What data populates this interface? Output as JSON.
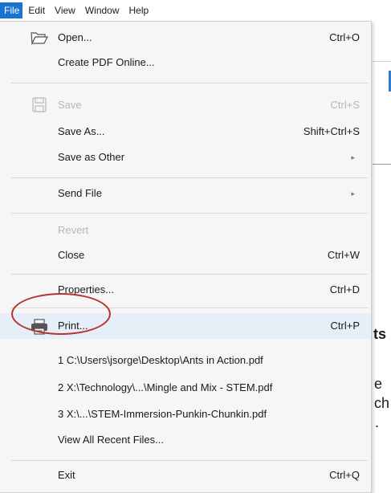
{
  "menubar": {
    "items": [
      "File",
      "Edit",
      "View",
      "Window",
      "Help"
    ],
    "active_color": "#1874d2"
  },
  "background_doc": {
    "fragment_ts": "ts",
    "fragment_e": "e",
    "fragment_ch": "ch",
    "fragment_dot": "."
  },
  "menu": {
    "open": {
      "label": "Open...",
      "shortcut": "Ctrl+O",
      "icon": "folder-open-icon"
    },
    "create": {
      "label": "Create PDF Online..."
    },
    "save": {
      "label": "Save",
      "shortcut": "Ctrl+S",
      "icon": "save-disk-icon",
      "disabled": true
    },
    "save_as": {
      "label": "Save As...",
      "shortcut": "Shift+Ctrl+S"
    },
    "save_other": {
      "label": "Save as Other",
      "arrow": "▸"
    },
    "send_file": {
      "label": "Send File",
      "arrow": "▸"
    },
    "revert": {
      "label": "Revert",
      "disabled": true
    },
    "close": {
      "label": "Close",
      "shortcut": "Ctrl+W"
    },
    "properties": {
      "label": "Properties...",
      "shortcut": "Ctrl+D"
    },
    "print": {
      "label": "Print...",
      "shortcut": "Ctrl+P",
      "icon": "printer-icon"
    },
    "recent": [
      "1 C:\\Users\\jsorge\\Desktop\\Ants in Action.pdf",
      "2 X:\\Technology\\...\\Mingle and Mix - STEM.pdf",
      "3 X:\\...\\STEM-Immersion-Punkin-Chunkin.pdf"
    ],
    "view_all": {
      "label": "View All Recent Files..."
    },
    "exit": {
      "label": "Exit",
      "shortcut": "Ctrl+Q"
    }
  },
  "annotation": {
    "color": "#b83230",
    "target": "print"
  }
}
